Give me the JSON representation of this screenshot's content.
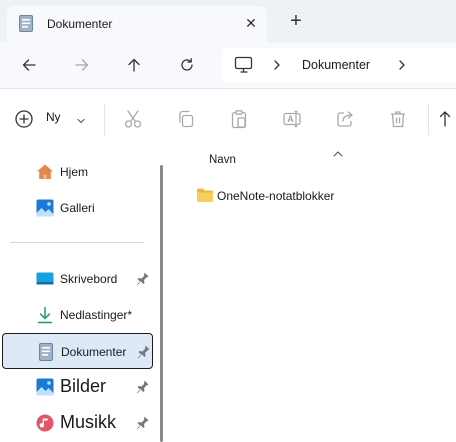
{
  "tab": {
    "title": "Dokumenter",
    "close_glyph": "✕",
    "new_glyph": "+"
  },
  "address": {
    "location": "Dokumenter"
  },
  "toolbar": {
    "new_label": "Ny"
  },
  "sidebar": {
    "items": [
      {
        "label": "Hjem",
        "icon": "home-icon"
      },
      {
        "label": "Galleri",
        "icon": "gallery-icon"
      },
      {
        "label": "Skrivebord",
        "icon": "desktop-icon",
        "pinned": true
      },
      {
        "label": "Nedlastinger*",
        "icon": "download-icon",
        "pinned": true
      },
      {
        "label": "Dokumenter",
        "icon": "documents-icon",
        "pinned": true,
        "selected": true
      },
      {
        "label": "Bilder",
        "icon": "pictures-icon",
        "pinned": true
      },
      {
        "label": "Musikk",
        "icon": "music-icon",
        "pinned": true
      }
    ]
  },
  "content": {
    "column_header": "Navn",
    "files": [
      {
        "name": "OneNote-notatblokker",
        "icon": "folder-icon"
      }
    ]
  },
  "colors": {
    "accent": "#0067c0",
    "selected_bg": "#dde9f7",
    "folder": "#f8c84a",
    "tab_strip": "#eef1f6"
  }
}
